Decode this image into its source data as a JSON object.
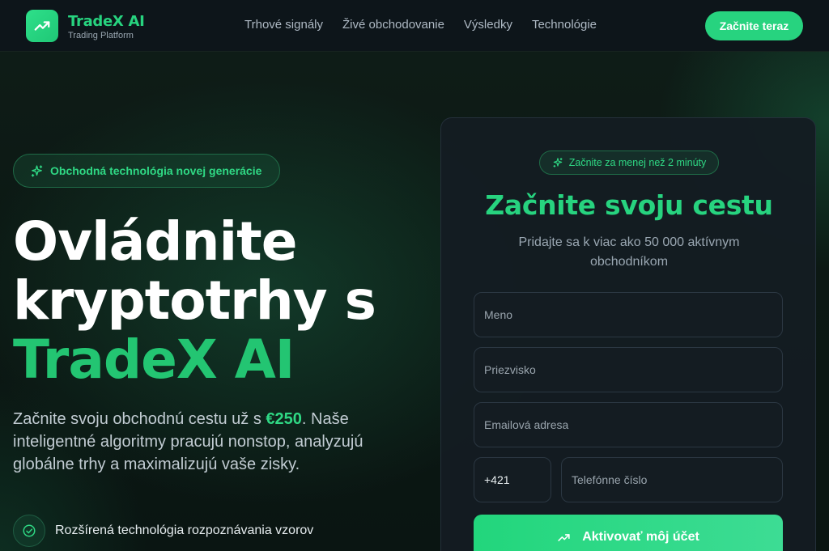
{
  "nav": {
    "brand": "TradeX AI",
    "brand_sub": "Trading Platform",
    "logo_icon": "trending-up-icon",
    "links": [
      "Trhové signály",
      "Živé obchodovanie",
      "Výsledky",
      "Technológie"
    ],
    "cta": "Začnite teraz"
  },
  "hero": {
    "badge": "Obchodná technológia novej generácie",
    "badge_icon": "sparkles-icon",
    "headline_line1": "Ovládnite",
    "headline_line2": "kryptotrhy s",
    "headline_accent": "TradeX AI",
    "desc_before": "Začnite svoju obchodnú cestu už s ",
    "desc_price": "€250",
    "desc_after": ". Naše inteligentné algoritmy pracujú nonstop, analyzujú globálne trhy a maximalizujú vaše zisky.",
    "feature_1": "Rozšírená technológia rozpoznávania vzorov",
    "feature_icon": "check-circle-icon"
  },
  "form": {
    "badge": "Začnite za menej než 2 minúty",
    "title": "Začnite svoju cestu",
    "subtitle": "Pridajte sa k viac ako 50 000 aktívnym obchodníkom",
    "first_name_placeholder": "Meno",
    "last_name_placeholder": "Priezvisko",
    "email_placeholder": "Emailová adresa",
    "phone_prefix": "+421",
    "phone_placeholder": "Telefónne číslo",
    "submit": "Aktivovať môj účet",
    "submit_icon": "trending-up-icon"
  },
  "colors": {
    "accent": "#27d37f",
    "background": "#0b1411",
    "card": "#141c22"
  }
}
